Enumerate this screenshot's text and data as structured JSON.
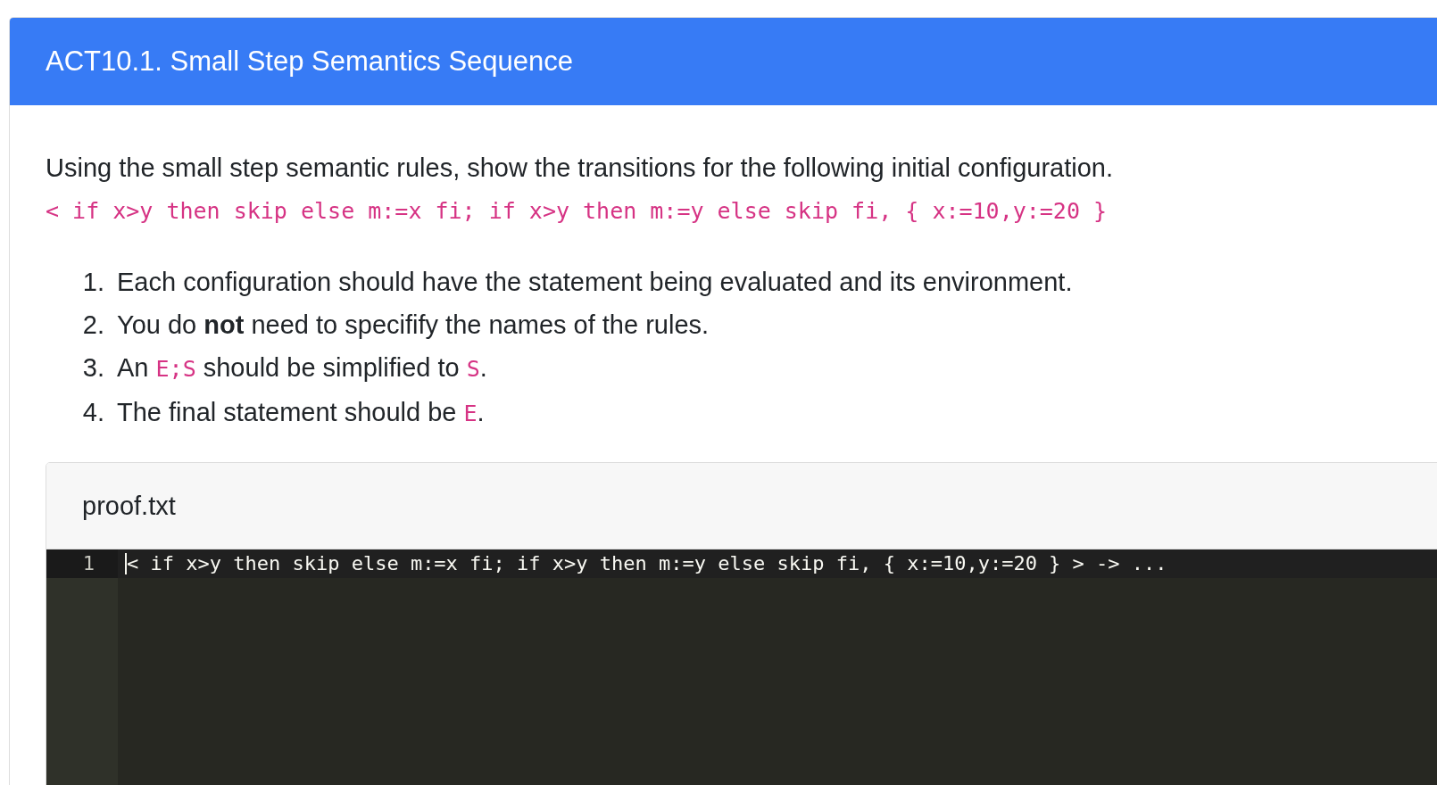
{
  "card": {
    "title": "ACT10.1. Small Step Semantics Sequence"
  },
  "prompt": "Using the small step semantic rules, show the transitions for the following initial configuration.",
  "configuration": "< if x>y then skip else m:=x fi; if x>y then m:=y else skip fi, { x:=10,y:=20 }",
  "instructions": [
    {
      "number": "1.",
      "parts": [
        {
          "kind": "text",
          "text": "Each configuration should have the statement being evaluated and its environment."
        }
      ]
    },
    {
      "number": "2.",
      "parts": [
        {
          "kind": "text",
          "text": "You do **not** need to specifify the names of the rules."
        }
      ]
    },
    {
      "number": "3.",
      "parts": [
        {
          "kind": "text",
          "text": "An "
        },
        {
          "kind": "code",
          "text": "E;S"
        },
        {
          "kind": "text",
          "text": " should be simplified to "
        },
        {
          "kind": "code",
          "text": "S"
        },
        {
          "kind": "text",
          "text": "."
        }
      ]
    },
    {
      "number": "4.",
      "parts": [
        {
          "kind": "text",
          "text": "The final statement should be "
        },
        {
          "kind": "code",
          "text": "E"
        },
        {
          "kind": "text",
          "text": "."
        }
      ]
    }
  ],
  "editor": {
    "filename": "proof.txt",
    "lines": [
      {
        "number": "1",
        "text": "< if x>y then skip else m:=x fi; if x>y then m:=y else skip fi, { x:=10,y:=20 } > -> ...",
        "selected": true
      }
    ]
  }
}
